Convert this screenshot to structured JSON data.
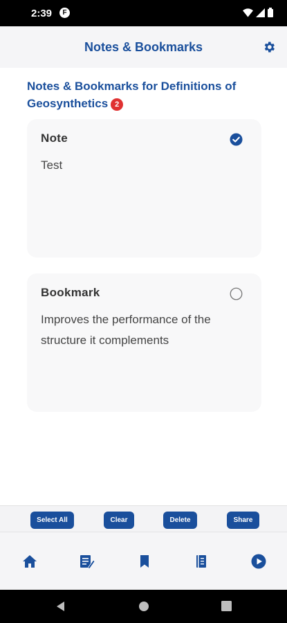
{
  "status_bar": {
    "time": "2:39",
    "app_icon_letter": "F"
  },
  "header": {
    "title": "Notes & Bookmarks"
  },
  "page": {
    "title": "Notes & Bookmarks for Definitions of Geosynthetics",
    "count": "2"
  },
  "items": [
    {
      "type": "Note",
      "text": "Test",
      "checked": true
    },
    {
      "type": "Bookmark",
      "text": "Improves the performance of the structure it complements",
      "checked": false
    }
  ],
  "actions": {
    "select_all": "Select All",
    "clear": "Clear",
    "delete": "Delete",
    "share": "Share"
  },
  "bottom_nav": [
    "home-icon",
    "notes-edit-icon",
    "bookmark-icon",
    "book-icon",
    "play-icon"
  ],
  "colors": {
    "primary": "#1a4f9c",
    "badge": "#e03131",
    "card": "#f8f8f9"
  }
}
